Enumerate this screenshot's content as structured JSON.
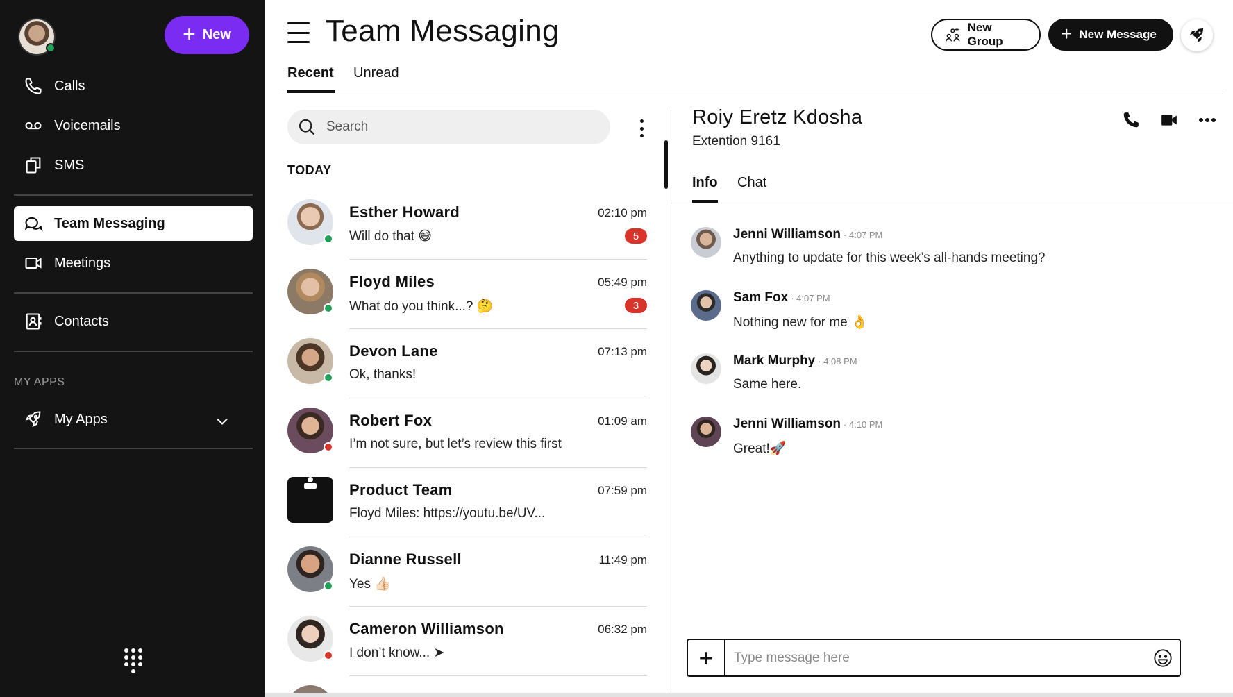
{
  "app": {
    "title": "Team Messaging"
  },
  "sidebar": {
    "new_label": "New",
    "items": [
      {
        "label": "Calls",
        "icon": "phone-icon"
      },
      {
        "label": "Voicemails",
        "icon": "voicemail-icon"
      },
      {
        "label": "SMS",
        "icon": "sms-icon"
      },
      {
        "label": "Team Messaging",
        "icon": "chat-bubbles-icon",
        "active": true
      },
      {
        "label": "Meetings",
        "icon": "video-icon"
      },
      {
        "label": "Contacts",
        "icon": "contacts-icon"
      },
      {
        "label": "My Apps",
        "icon": "rocket-icon"
      }
    ],
    "section_my_apps": "MY APPS"
  },
  "header": {
    "tabs": [
      {
        "label": "Recent",
        "active": true
      },
      {
        "label": "Unread"
      }
    ],
    "new_group_label": "New Group",
    "new_message_label": "New Message"
  },
  "list": {
    "search_placeholder": "Search",
    "section_today": "TODAY",
    "conversations": [
      {
        "name": "Esther Howard",
        "time": "02:10 pm",
        "preview": "Will do that 😅",
        "badge": "5",
        "presence": "#22a05a"
      },
      {
        "name": "Floyd Miles",
        "time": "05:49 pm",
        "preview": "What do you think...? 🤔",
        "badge": "3",
        "presence": "#22a05a"
      },
      {
        "name": "Devon Lane",
        "time": "07:13 pm",
        "preview": "Ok, thanks!",
        "badge": "",
        "presence": "#22a05a"
      },
      {
        "name": "Robert Fox",
        "time": "01:09 am",
        "preview": "I’m not sure, but let’s review this first",
        "badge": "",
        "presence": "#d9342b"
      },
      {
        "name": "Product Team",
        "time": "07:59 pm",
        "preview": "Floyd Miles: https://youtu.be/UV...",
        "badge": "",
        "presence": ""
      },
      {
        "name": "Dianne Russell",
        "time": "11:49 pm",
        "preview": "Yes 👍🏻",
        "badge": "",
        "presence": "#22a05a"
      },
      {
        "name": "Cameron Williamson",
        "time": "06:32 pm",
        "preview": "I don’t know... ➤",
        "badge": "",
        "presence": "#d9342b"
      }
    ]
  },
  "detail": {
    "name": "Roiy Eretz Kdosha",
    "extension": "Extention 9161",
    "tabs": [
      {
        "label": "Info",
        "active": true
      },
      {
        "label": "Chat"
      }
    ],
    "messages": [
      {
        "sender": "Jenni Williamson",
        "time": "· 4:07 PM",
        "text": "Anything to update for this week’s all-hands meeting?"
      },
      {
        "sender": "Sam Fox",
        "time": "· 4:07 PM",
        "text": "Nothing new for me 👌"
      },
      {
        "sender": "Mark Murphy",
        "time": "· 4:08 PM",
        "text": "Same here."
      },
      {
        "sender": "Jenni Williamson",
        "time": "· 4:10 PM",
        "text": "Great!🚀"
      }
    ],
    "composer_placeholder": "Type message here"
  },
  "colors": {
    "accent": "#7b2cf2",
    "sidebar_bg": "#141414",
    "badge": "#d9342b",
    "online": "#22a05a",
    "busy": "#d9342b"
  }
}
